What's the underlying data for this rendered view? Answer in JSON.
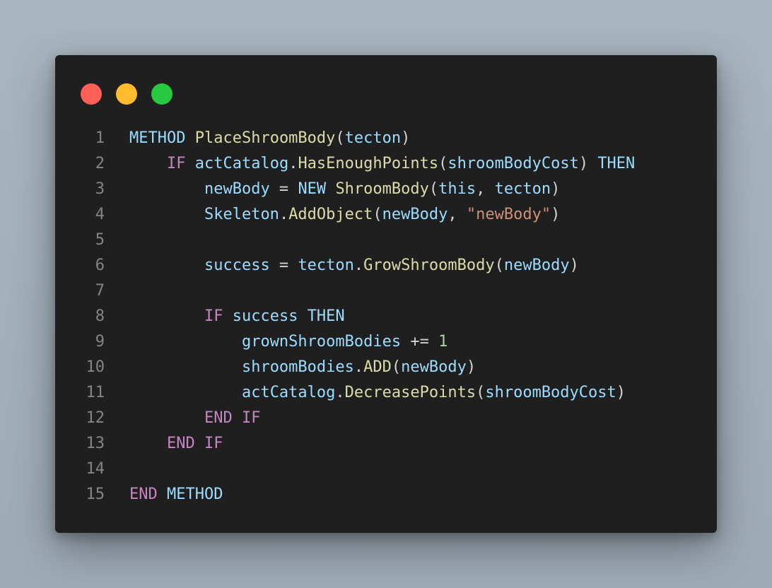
{
  "window": {
    "controls": [
      "close",
      "minimize",
      "maximize"
    ]
  },
  "code": {
    "lines": [
      {
        "n": "1",
        "tokens": [
          {
            "t": "METHOD",
            "c": "kw-blue"
          },
          {
            "t": " ",
            "c": "punc"
          },
          {
            "t": "PlaceShroomBody",
            "c": "fn"
          },
          {
            "t": "(",
            "c": "punc"
          },
          {
            "t": "tecton",
            "c": "id"
          },
          {
            "t": ")",
            "c": "punc"
          }
        ]
      },
      {
        "n": "2",
        "tokens": [
          {
            "t": "    ",
            "c": "punc"
          },
          {
            "t": "IF",
            "c": "kw-pink"
          },
          {
            "t": " ",
            "c": "punc"
          },
          {
            "t": "actCatalog",
            "c": "id"
          },
          {
            "t": ".",
            "c": "punc"
          },
          {
            "t": "HasEnoughPoints",
            "c": "fn"
          },
          {
            "t": "(",
            "c": "punc"
          },
          {
            "t": "shroomBodyCost",
            "c": "id"
          },
          {
            "t": ") ",
            "c": "punc"
          },
          {
            "t": "THEN",
            "c": "kw-blue"
          }
        ]
      },
      {
        "n": "3",
        "tokens": [
          {
            "t": "        ",
            "c": "punc"
          },
          {
            "t": "newBody",
            "c": "id"
          },
          {
            "t": " = ",
            "c": "punc"
          },
          {
            "t": "NEW",
            "c": "kw-blue"
          },
          {
            "t": " ",
            "c": "punc"
          },
          {
            "t": "ShroomBody",
            "c": "fn"
          },
          {
            "t": "(",
            "c": "punc"
          },
          {
            "t": "this",
            "c": "id"
          },
          {
            "t": ", ",
            "c": "punc"
          },
          {
            "t": "tecton",
            "c": "id"
          },
          {
            "t": ")",
            "c": "punc"
          }
        ]
      },
      {
        "n": "4",
        "tokens": [
          {
            "t": "        ",
            "c": "punc"
          },
          {
            "t": "Skeleton",
            "c": "id"
          },
          {
            "t": ".",
            "c": "punc"
          },
          {
            "t": "AddObject",
            "c": "fn"
          },
          {
            "t": "(",
            "c": "punc"
          },
          {
            "t": "newBody",
            "c": "id"
          },
          {
            "t": ", ",
            "c": "punc"
          },
          {
            "t": "\"newBody\"",
            "c": "str"
          },
          {
            "t": ")",
            "c": "punc"
          }
        ]
      },
      {
        "n": "5",
        "tokens": []
      },
      {
        "n": "6",
        "tokens": [
          {
            "t": "        ",
            "c": "punc"
          },
          {
            "t": "success",
            "c": "id"
          },
          {
            "t": " = ",
            "c": "punc"
          },
          {
            "t": "tecton",
            "c": "id"
          },
          {
            "t": ".",
            "c": "punc"
          },
          {
            "t": "GrowShroomBody",
            "c": "fn"
          },
          {
            "t": "(",
            "c": "punc"
          },
          {
            "t": "newBody",
            "c": "id"
          },
          {
            "t": ")",
            "c": "punc"
          }
        ]
      },
      {
        "n": "7",
        "tokens": []
      },
      {
        "n": "8",
        "tokens": [
          {
            "t": "        ",
            "c": "punc"
          },
          {
            "t": "IF",
            "c": "kw-pink"
          },
          {
            "t": " ",
            "c": "punc"
          },
          {
            "t": "success",
            "c": "id"
          },
          {
            "t": " ",
            "c": "punc"
          },
          {
            "t": "THEN",
            "c": "kw-blue"
          }
        ]
      },
      {
        "n": "9",
        "tokens": [
          {
            "t": "            ",
            "c": "punc"
          },
          {
            "t": "grownShroomBodies",
            "c": "id"
          },
          {
            "t": " += ",
            "c": "punc"
          },
          {
            "t": "1",
            "c": "num"
          }
        ]
      },
      {
        "n": "10",
        "tokens": [
          {
            "t": "            ",
            "c": "punc"
          },
          {
            "t": "shroomBodies",
            "c": "id"
          },
          {
            "t": ".",
            "c": "punc"
          },
          {
            "t": "ADD",
            "c": "fn"
          },
          {
            "t": "(",
            "c": "punc"
          },
          {
            "t": "newBody",
            "c": "id"
          },
          {
            "t": ")",
            "c": "punc"
          }
        ]
      },
      {
        "n": "11",
        "tokens": [
          {
            "t": "            ",
            "c": "punc"
          },
          {
            "t": "actCatalog",
            "c": "id"
          },
          {
            "t": ".",
            "c": "punc"
          },
          {
            "t": "DecreasePoints",
            "c": "fn"
          },
          {
            "t": "(",
            "c": "punc"
          },
          {
            "t": "shroomBodyCost",
            "c": "id"
          },
          {
            "t": ")",
            "c": "punc"
          }
        ]
      },
      {
        "n": "12",
        "tokens": [
          {
            "t": "        ",
            "c": "punc"
          },
          {
            "t": "END",
            "c": "kw-pink"
          },
          {
            "t": " ",
            "c": "punc"
          },
          {
            "t": "IF",
            "c": "kw-pink"
          }
        ]
      },
      {
        "n": "13",
        "tokens": [
          {
            "t": "    ",
            "c": "punc"
          },
          {
            "t": "END",
            "c": "kw-pink"
          },
          {
            "t": " ",
            "c": "punc"
          },
          {
            "t": "IF",
            "c": "kw-pink"
          }
        ]
      },
      {
        "n": "14",
        "tokens": []
      },
      {
        "n": "15",
        "tokens": [
          {
            "t": "END",
            "c": "kw-pink"
          },
          {
            "t": " ",
            "c": "punc"
          },
          {
            "t": "METHOD",
            "c": "kw-blue"
          }
        ]
      }
    ]
  },
  "colors": {
    "background": "#a9b5c1",
    "window": "#1f1f1f",
    "close": "#ff5f57",
    "minimize": "#febc2e",
    "maximize": "#28c840"
  }
}
